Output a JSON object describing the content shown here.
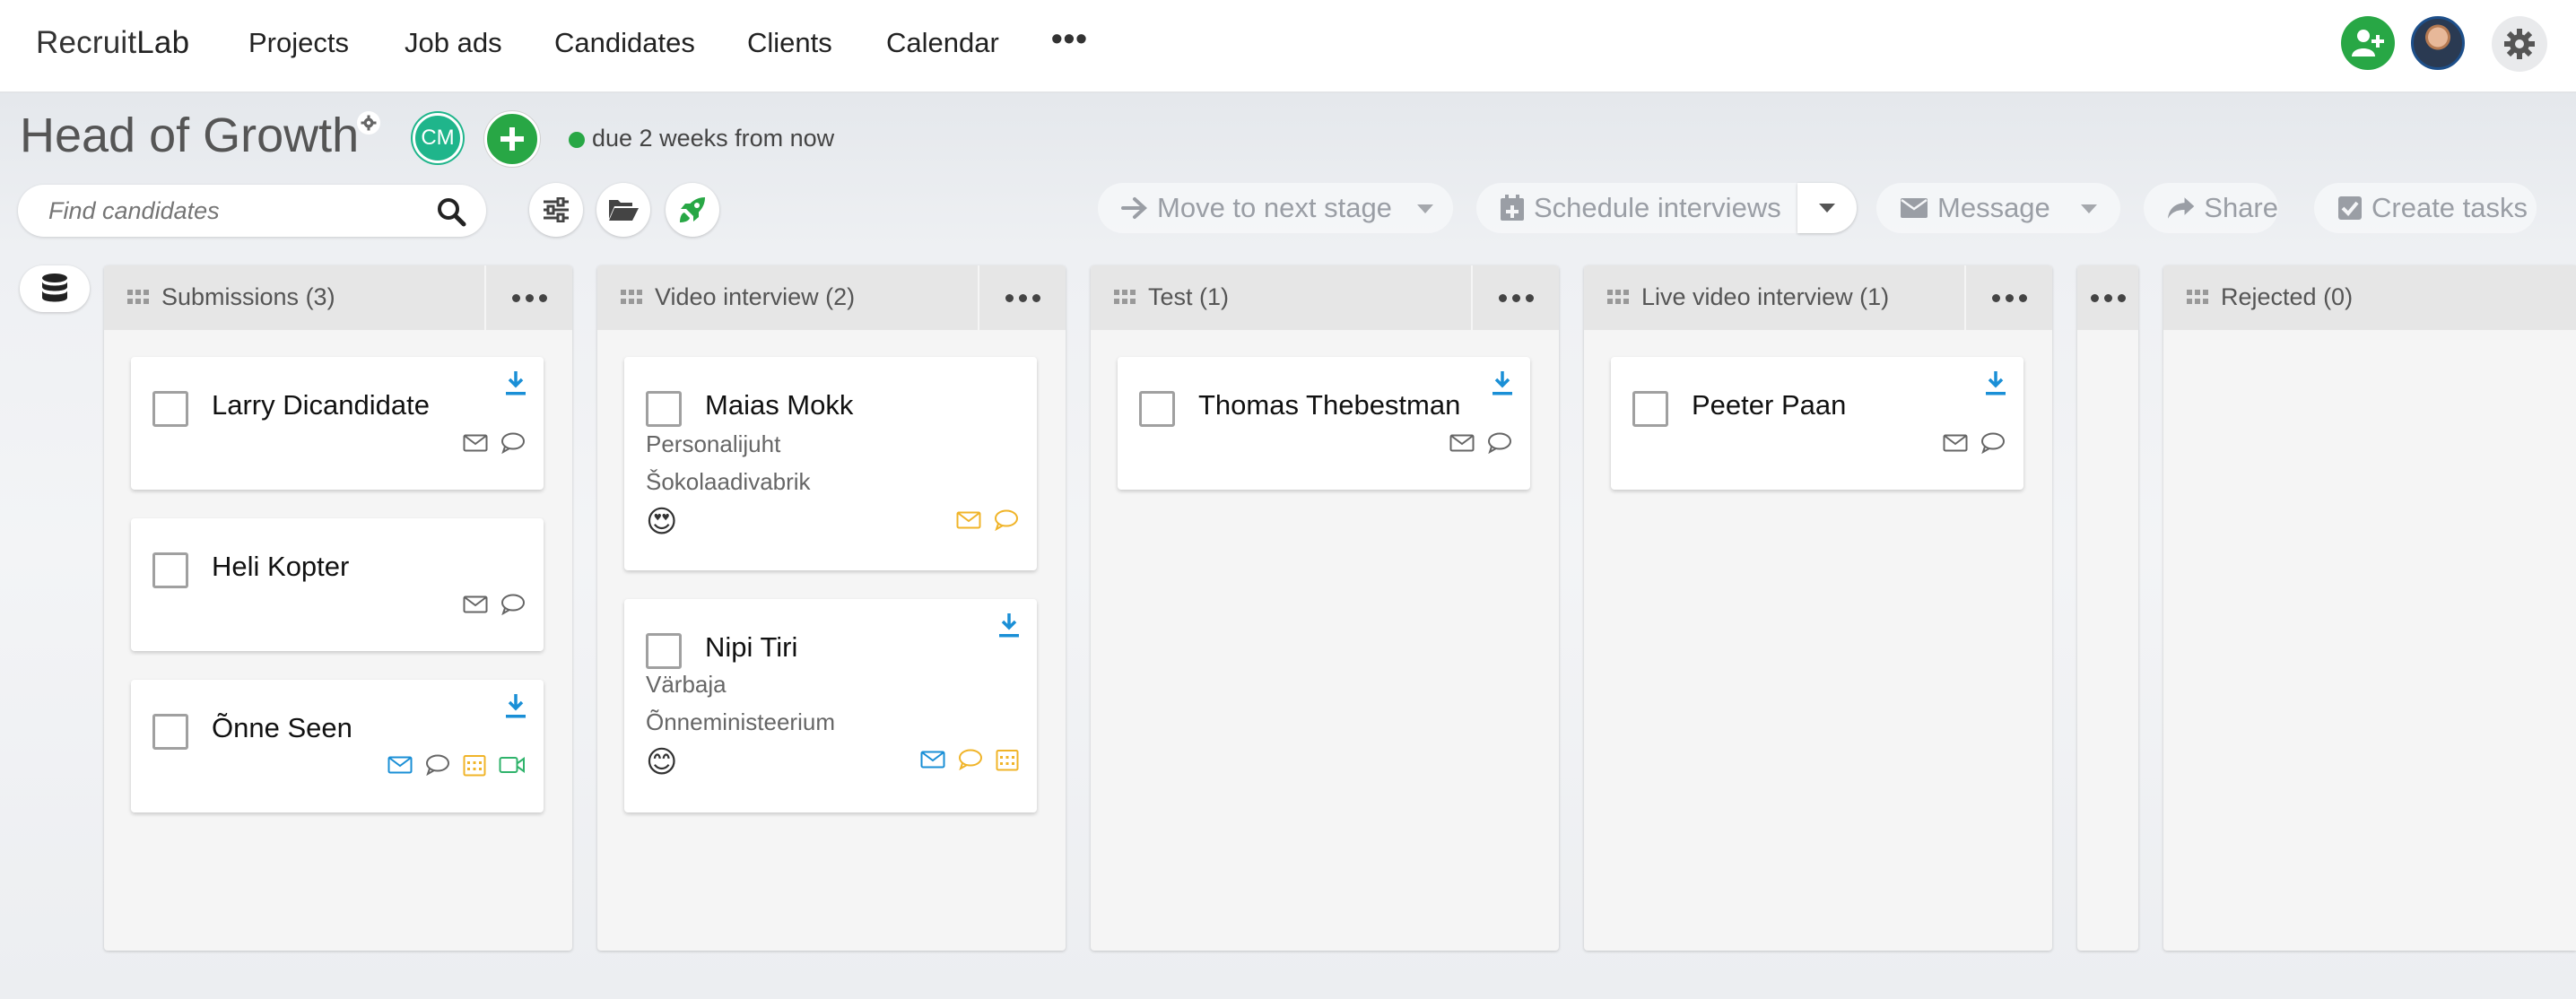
{
  "nav": {
    "logo_regular": "Recruit",
    "logo_bold": "Lab",
    "items": [
      "Projects",
      "Job ads",
      "Candidates",
      "Clients",
      "Calendar"
    ],
    "more": "•••"
  },
  "header": {
    "title": "Head of Growth",
    "owner_initials": "CM",
    "due": "due 2 weeks from now",
    "status_color": "#28a745"
  },
  "toolbar": {
    "search_placeholder": "Find candidates",
    "move_next": "Move to next stage",
    "schedule": "Schedule interviews",
    "message": "Message",
    "share": "Share",
    "create_tasks": "Create tasks"
  },
  "columns": [
    {
      "title": "Submissions (3)",
      "cards": [
        {
          "name": "Larry Dicandidate"
        },
        {
          "name": "Heli Kopter"
        },
        {
          "name": "Õnne Seen"
        }
      ]
    },
    {
      "title": "Video interview (2)",
      "cards": [
        {
          "name": "Maias Mokk",
          "role": "Personalijuht",
          "company": "Šokolaadivabrik",
          "emoji": "😍"
        },
        {
          "name": "Nipi Tiri",
          "role": "Värbaja",
          "company": "Õnneministeerium",
          "emoji": "😊"
        }
      ]
    },
    {
      "title": "Test (1)",
      "cards": [
        {
          "name": "Thomas Thebestman"
        }
      ]
    },
    {
      "title": "Live video interview (1)",
      "cards": [
        {
          "name": "Peeter Paan"
        }
      ]
    },
    {
      "title": "Rejected (0)",
      "cards": []
    }
  ],
  "colors": {
    "accent_green": "#28a745",
    "link_blue": "#1a8fd6",
    "warn_yellow": "#f0b429",
    "video_green": "#2fb36b"
  }
}
